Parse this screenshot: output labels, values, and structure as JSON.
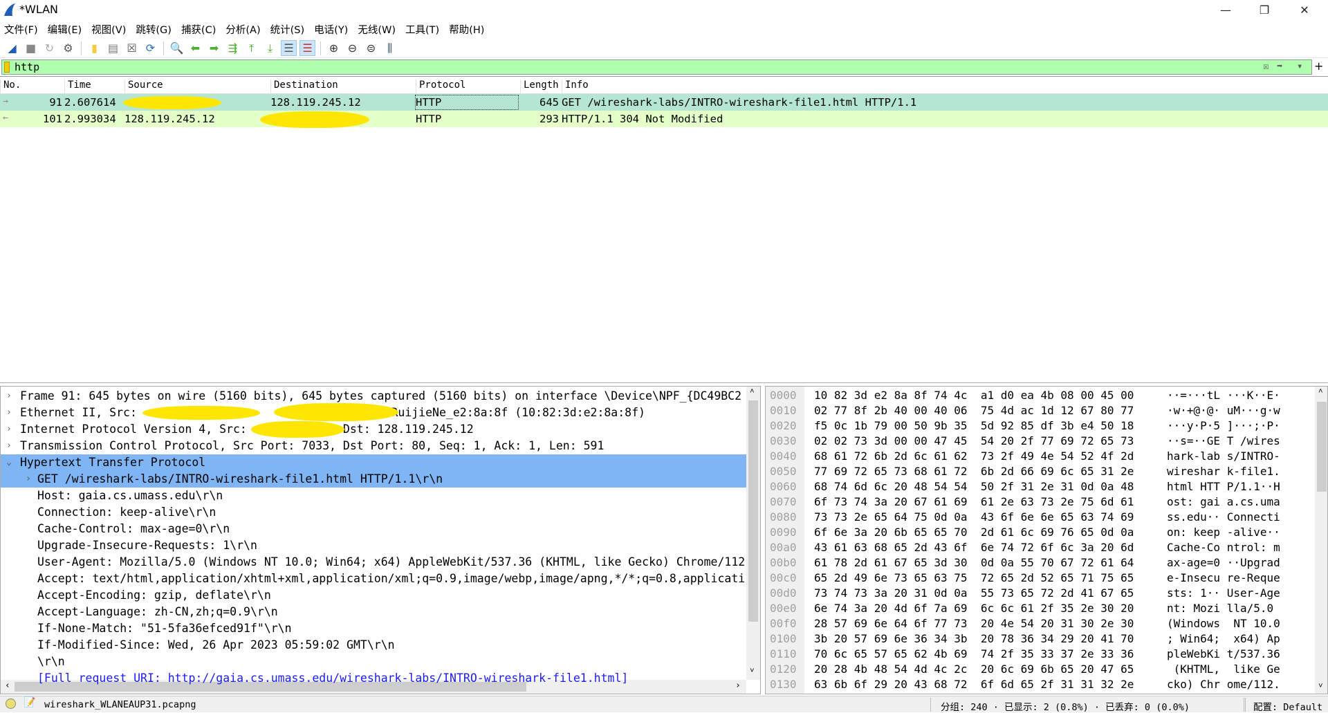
{
  "window": {
    "title": "*WLAN",
    "controls": [
      "minimize",
      "restore",
      "close"
    ]
  },
  "menu": [
    "文件(F)",
    "编辑(E)",
    "视图(V)",
    "跳转(G)",
    "捕获(C)",
    "分析(A)",
    "统计(S)",
    "电话(Y)",
    "无线(W)",
    "工具(T)",
    "帮助(H)"
  ],
  "toolbar": [
    "shark-fin-start-icon",
    "stop-icon",
    "restart-icon",
    "options-gear-icon",
    "open-folder-icon",
    "file-icon",
    "close-file-icon",
    "reload-icon",
    "find-icon",
    "back-arrow-icon",
    "forward-arrow-icon",
    "go-to-packet-icon",
    "first-packet-icon",
    "last-packet-icon",
    "autoscroll-icon",
    "colorize-icon",
    "zoom-in-icon",
    "zoom-out-icon",
    "zoom-normal-icon",
    "resize-columns-icon"
  ],
  "filter": {
    "value": "http"
  },
  "packet_list": {
    "columns": [
      "No.",
      "Time",
      "Source",
      "Destination",
      "Protocol",
      "Length",
      "Info"
    ],
    "rows": [
      {
        "no": "91",
        "time": "2.607614",
        "source": "",
        "destination": "128.119.245.12",
        "protocol": "HTTP",
        "length": "645",
        "info": "GET /wireshark-labs/INTRO-wireshark-file1.html HTTP/1.1",
        "color": "#b5e6d2"
      },
      {
        "no": "101",
        "time": "2.993034",
        "source": "128.119.245.12",
        "destination": "",
        "protocol": "HTTP",
        "length": "293",
        "info": "HTTP/1.1 304 Not Modified",
        "color": "#e4ffc7"
      }
    ]
  },
  "details": [
    {
      "text": "Frame 91: 645 bytes on wire (5160 bits), 645 bytes captured (5160 bits) on interface \\Device\\NPF_{DC49BC2",
      "level": 0,
      "exp": "›"
    },
    {
      "text": "Ethernet II, Src:                              , Dst: RuijieNe_e2:8a:8f (10:82:3d:e2:8a:8f)",
      "level": 0,
      "exp": "›"
    },
    {
      "text": "Internet Protocol Version 4, Src:            , Dst: 128.119.245.12",
      "level": 0,
      "exp": "›"
    },
    {
      "text": "Transmission Control Protocol, Src Port: 7033, Dst Port: 80, Seq: 1, Ack: 1, Len: 591",
      "level": 0,
      "exp": "›"
    },
    {
      "text": "Hypertext Transfer Protocol",
      "level": 0,
      "exp": "⌄",
      "selected": true
    },
    {
      "text": "GET /wireshark-labs/INTRO-wireshark-file1.html HTTP/1.1\\r\\n",
      "level": 1,
      "exp": "›",
      "selected": true
    },
    {
      "text": "Host: gaia.cs.umass.edu\\r\\n",
      "level": 1
    },
    {
      "text": "Connection: keep-alive\\r\\n",
      "level": 1
    },
    {
      "text": "Cache-Control: max-age=0\\r\\n",
      "level": 1
    },
    {
      "text": "Upgrade-Insecure-Requests: 1\\r\\n",
      "level": 1
    },
    {
      "text": "User-Agent: Mozilla/5.0 (Windows NT 10.0; Win64; x64) AppleWebKit/537.36 (KHTML, like Gecko) Chrome/112",
      "level": 1
    },
    {
      "text": "Accept: text/html,application/xhtml+xml,application/xml;q=0.9,image/webp,image/apng,*/*;q=0.8,applicati",
      "level": 1
    },
    {
      "text": "Accept-Encoding: gzip, deflate\\r\\n",
      "level": 1
    },
    {
      "text": "Accept-Language: zh-CN,zh;q=0.9\\r\\n",
      "level": 1
    },
    {
      "text": "If-None-Match: \"51-5fa36efced91f\"\\r\\n",
      "level": 1
    },
    {
      "text": "If-Modified-Since: Wed, 26 Apr 2023 05:59:02 GMT\\r\\n",
      "level": 1
    },
    {
      "text": "\\r\\n",
      "level": 1
    },
    {
      "text": "[Full request URI: http://gaia.cs.umass.edu/wireshark-labs/INTRO-wireshark-file1.html]",
      "level": 1,
      "link": true
    }
  ],
  "hex": [
    {
      "o": "0000",
      "h": "10 82 3d e2 8a 8f 74 4c  a1 d0 ea 4b 08 00 45 00",
      "a": "··=···tL ···K··E·"
    },
    {
      "o": "0010",
      "h": "02 77 8f 2b 40 00 40 06  75 4d ac 1d 12 67 80 77",
      "a": "·w·+@·@· uM···g·w"
    },
    {
      "o": "0020",
      "h": "f5 0c 1b 79 00 50 9b 35  5d 92 85 df 3b e4 50 18",
      "a": "···y·P·5 ]···;·P·"
    },
    {
      "o": "0030",
      "h": "02 02 73 3d 00 00 47 45  54 20 2f 77 69 72 65 73",
      "a": "··s=··GE T /wires"
    },
    {
      "o": "0040",
      "h": "68 61 72 6b 2d 6c 61 62  73 2f 49 4e 54 52 4f 2d",
      "a": "hark-lab s/INTRO-"
    },
    {
      "o": "0050",
      "h": "77 69 72 65 73 68 61 72  6b 2d 66 69 6c 65 31 2e",
      "a": "wireshar k-file1."
    },
    {
      "o": "0060",
      "h": "68 74 6d 6c 20 48 54 54  50 2f 31 2e 31 0d 0a 48",
      "a": "html HTT P/1.1··H"
    },
    {
      "o": "0070",
      "h": "6f 73 74 3a 20 67 61 69  61 2e 63 73 2e 75 6d 61",
      "a": "ost: gai a.cs.uma"
    },
    {
      "o": "0080",
      "h": "73 73 2e 65 64 75 0d 0a  43 6f 6e 6e 65 63 74 69",
      "a": "ss.edu·· Connecti"
    },
    {
      "o": "0090",
      "h": "6f 6e 3a 20 6b 65 65 70  2d 61 6c 69 76 65 0d 0a",
      "a": "on: keep -alive··"
    },
    {
      "o": "00a0",
      "h": "43 61 63 68 65 2d 43 6f  6e 74 72 6f 6c 3a 20 6d",
      "a": "Cache-Co ntrol: m"
    },
    {
      "o": "00b0",
      "h": "61 78 2d 61 67 65 3d 30  0d 0a 55 70 67 72 61 64",
      "a": "ax-age=0 ··Upgrad"
    },
    {
      "o": "00c0",
      "h": "65 2d 49 6e 73 65 63 75  72 65 2d 52 65 71 75 65",
      "a": "e-Insecu re-Reque"
    },
    {
      "o": "00d0",
      "h": "73 74 73 3a 20 31 0d 0a  55 73 65 72 2d 41 67 65",
      "a": "sts: 1·· User-Age"
    },
    {
      "o": "00e0",
      "h": "6e 74 3a 20 4d 6f 7a 69  6c 6c 61 2f 35 2e 30 20",
      "a": "nt: Mozi lla/5.0 "
    },
    {
      "o": "00f0",
      "h": "28 57 69 6e 64 6f 77 73  20 4e 54 20 31 30 2e 30",
      "a": "(Windows  NT 10.0"
    },
    {
      "o": "0100",
      "h": "3b 20 57 69 6e 36 34 3b  20 78 36 34 29 20 41 70",
      "a": "; Win64;  x64) Ap"
    },
    {
      "o": "0110",
      "h": "70 6c 65 57 65 62 4b 69  74 2f 35 33 37 2e 33 36",
      "a": "pleWebKi t/537.36"
    },
    {
      "o": "0120",
      "h": "20 28 4b 48 54 4d 4c 2c  20 6c 69 6b 65 20 47 65",
      "a": " (KHTML,  like Ge"
    },
    {
      "o": "0130",
      "h": "63 6b 6f 29 20 43 68 72  6f 6d 65 2f 31 31 32 2e",
      "a": "cko) Chr ome/112."
    }
  ],
  "status": {
    "file": "wireshark_WLANEAUP31.pcapng",
    "packets": "分组: 240 · 已显示: 2 (0.8%) · 已丢弃: 0 (0.0%)",
    "profile": "配置: Default"
  },
  "colors": {
    "filter_ok": "#afffaf",
    "selected": "#7fb5f5",
    "redaction": "#ffe600"
  }
}
